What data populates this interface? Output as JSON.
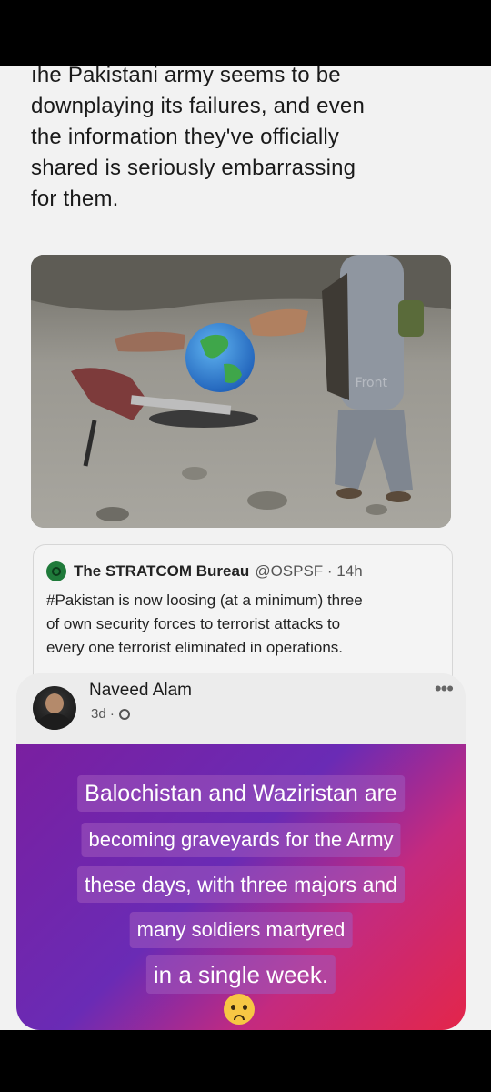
{
  "tweet": {
    "text_lines": [
      "ıhe Pakistani army seems to be",
      "downplaying its failures, and even",
      "the information they've officially",
      "shared is seriously embarrassing",
      "for them."
    ],
    "image_watermark": "Front"
  },
  "quote": {
    "name": "The STRATCOM Bureau",
    "handle": "@OSPSF · 14h",
    "text_lines": [
      "#Pakistan is now loosing (at a minimum) three",
      "of own security forces to terrorist attacks to",
      "every one terrorist eliminated in operations."
    ]
  },
  "fb_post": {
    "author": "Naveed Alam",
    "time": "3d ·",
    "more": "•••",
    "lines": [
      "Balochistan and Waziristan are",
      "becoming graveyards for the Army",
      "these days, with three majors and",
      "many soldiers martyred",
      "in a single week."
    ]
  }
}
